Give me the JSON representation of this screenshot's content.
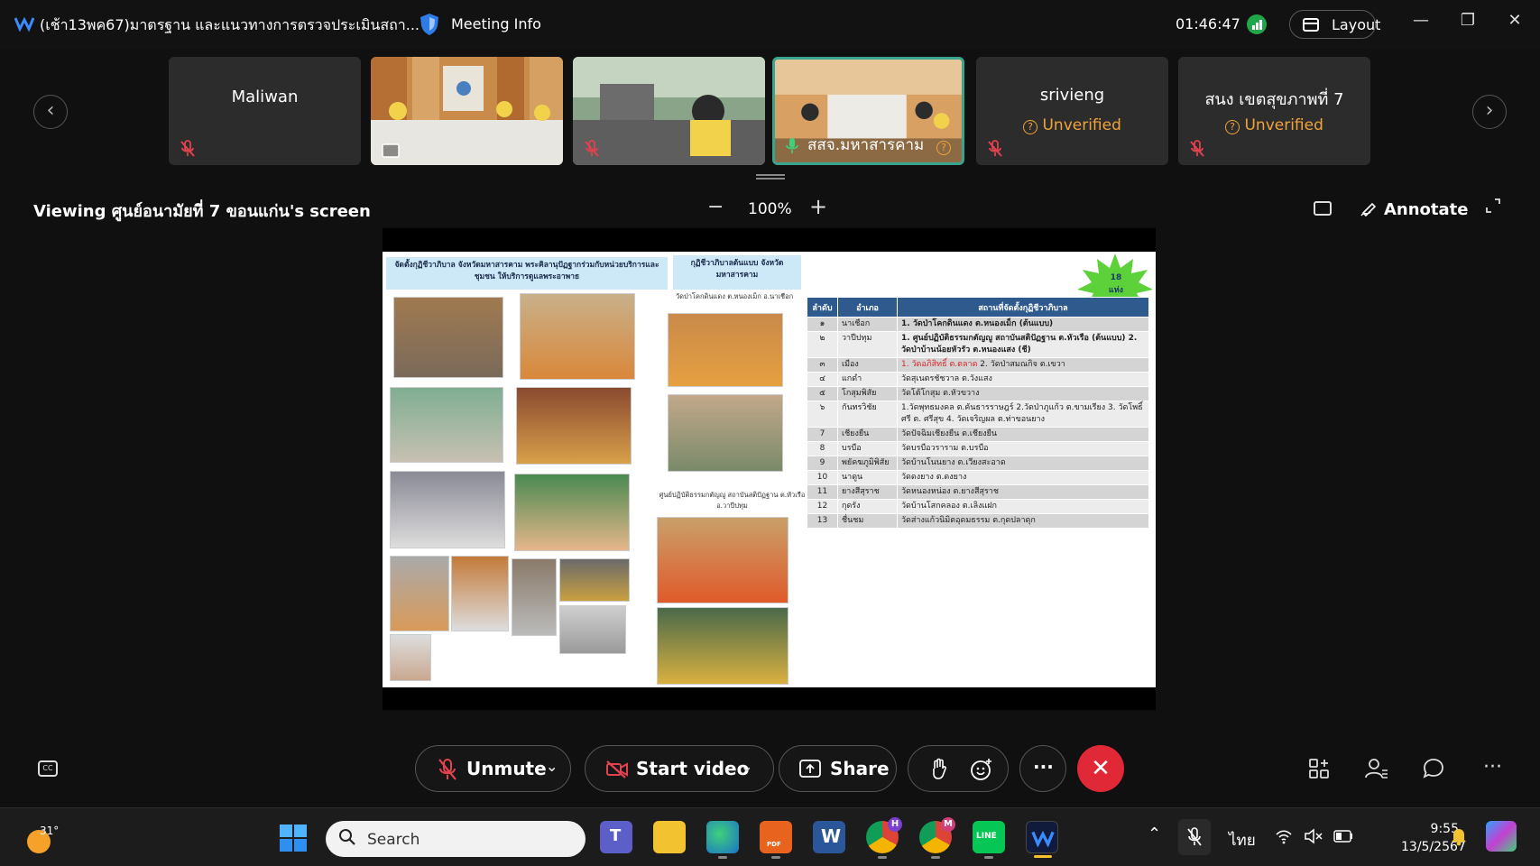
{
  "titlebar": {
    "meeting_title": "(เช้า13พค67)มาตรฐาน และแนวทางการตรวจประเมินสถา...",
    "meeting_info_label": "Meeting Info",
    "timer": "01:46:47",
    "layout_label": "Layout",
    "minimize_glyph": "—",
    "restore_glyph": "❐",
    "close_glyph": "✕"
  },
  "thumbnails": [
    {
      "name": "Maliwan",
      "unverified": false
    },
    {
      "name": "",
      "unverified": false
    },
    {
      "name": "",
      "unverified": false
    },
    {
      "name": "สสจ.มหาสารคาม",
      "unverified": false,
      "active": true
    },
    {
      "name": "srivieng",
      "unverified": true
    },
    {
      "name": "สนง เขตสุขภาพที่ 7",
      "unverified": true
    }
  ],
  "unverified_label": "Unverified",
  "viewing": {
    "label": "Viewing ศูนย์อนามัยที่ 7 ขอนแก่น's screen",
    "zoom": "100%",
    "zoom_minus": "−",
    "zoom_plus": "+",
    "annotate_label": "Annotate"
  },
  "slide": {
    "box_left": "จัดตั้งกุฏิชีวาภิบาล จังหวัดมหาสารคาม พระคิลานุปัฏฐากร่วมกับหน่วยบริการและชุมชน ให้บริการดูแลพระอาพาธ",
    "box_mid": "กุฏิชีวาภิบาลต้นแบบ จังหวัดมหาสารคาม",
    "cap_top": "วัดป่าโคกดินแดง ต.หนองเม็ก อ.นาเชือก",
    "cap_bottom": "ศูนย์ปฏิบัติธรรมกตัญญู สถาบันสติปัฏฐาน ต.หัวเรือ อ.วาปีปทุม",
    "star_count": "18",
    "star_unit": "แห่ง",
    "table_headers": [
      "ลำดับ",
      "อำเภอ",
      "สถานที่จัดตั้งกุฏิชีวาภิบาล"
    ],
    "rows": [
      {
        "no": "๑",
        "district": "นาเชือก",
        "place": "1. วัดป่าโคกดินแดง ต.หนองเม็ก (ต้นแบบ)"
      },
      {
        "no": "๒",
        "district": "วาปีปทุม",
        "place": "1. ศูนย์ปฏิบัติธรรมกตัญญู สถาบันสติปัฏฐาน ต.หัวเรือ (ต้นแบบ) 2. วัดป่าบ้านน้อยหัวรัว ต.หนองแสง (ชี)"
      },
      {
        "no": "๓",
        "district": "เมือง",
        "place_red": "1. วัดอภิสิทธิ์ ต.ตลาด",
        "place": " 2. วัดป่าสมณกิจ ต.เขวา"
      },
      {
        "no": "๔",
        "district": "แกดำ",
        "place": "วัดสุเนตรชัชวาล ต.วังแสง"
      },
      {
        "no": "๕",
        "district": "โกสุมพิสัย",
        "place": "วัดโต้โกสุม ต.หัวขวาง"
      },
      {
        "no": "๖",
        "district": "กันทรวิชัย",
        "place": "1.วัดพุทธมงคล ต.คันธารราษฎร์ 2.วัดป่าภูแก้ว ต.ขามเรียง 3. วัดโพธิ์ศรี ต. ศรีสุข 4. วัดเจริญผล ต.ท่าขอนยาง"
      },
      {
        "no": "7",
        "district": "เชียงยืน",
        "place": "วัดปัจฉิมเชียงยืน ต.เชียงยืน"
      },
      {
        "no": "8",
        "district": "บรบือ",
        "place": "วัดบรบือวราราม ต.บรบือ"
      },
      {
        "no": "9",
        "district": "พยัคฆภูมิพิสัย",
        "place": "วัดบ้านโนนยาง ต.เวียงสะอาด"
      },
      {
        "no": "10",
        "district": "นาดูน",
        "place": "วัดดงยาง ต.ดงยาง"
      },
      {
        "no": "11",
        "district": "ยางสีสุราช",
        "place": "วัดหนองหน่อง ต.ยางสีสุราช"
      },
      {
        "no": "12",
        "district": "กุดรัง",
        "place": "วัดบ้านโสกคลอง ต.เลิงแฝก"
      },
      {
        "no": "13",
        "district": "ชื่นชม",
        "place": "วัดส่างแก้วนิมิตอุดมธรรม ต.กุดปลาดุก"
      }
    ]
  },
  "controls": {
    "unmute": "Unmute",
    "start_video": "Start video",
    "share": "Share",
    "more": "···",
    "chevron": "⌄",
    "end_glyph": "✕",
    "cc": "CC"
  },
  "taskbar": {
    "temp": "31°",
    "search_placeholder": "Search",
    "lang": "ไทย",
    "time": "9:55",
    "date": "13/5/2567",
    "edge_badge": "H",
    "chrome_badge": "M",
    "line_label": "LINE"
  },
  "colors": {
    "accent_green": "#3aa58e",
    "end_red": "#e02836",
    "unverified_orange": "#f0a33a",
    "table_header_blue": "#2e5a8e"
  }
}
